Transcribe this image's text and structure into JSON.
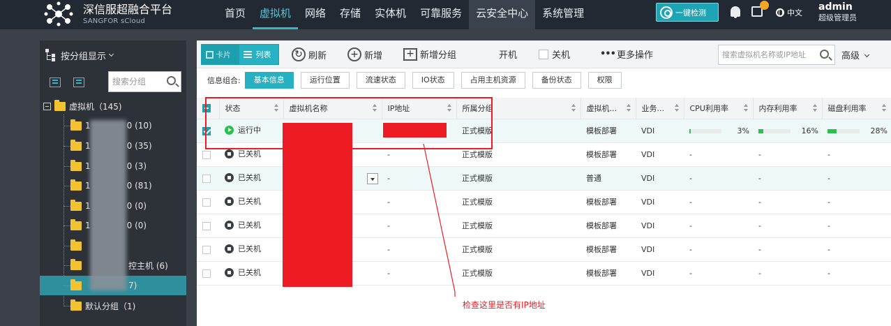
{
  "brand": {
    "title": "深信服超融合平台",
    "subtitle": "SANGFOR sCloud"
  },
  "nav": [
    "首页",
    "虚拟机",
    "网络",
    "存储",
    "实体机",
    "可靠服务",
    "云安全中心",
    "系统管理"
  ],
  "onekey_label": "一键检测",
  "lang": "中文",
  "user": {
    "name": "admin",
    "role": "超级管理员"
  },
  "tree": {
    "display_label": "按分组显示",
    "search_placeholder": "搜索分组",
    "root": "虚拟机（145)",
    "nodes": [
      "1",
      "1",
      "1",
      "1",
      "1",
      "1",
      "",
      "",
      "",
      "默认分组（1)"
    ],
    "suffixes": [
      "0 (10)",
      "0 (35)",
      "0 (3)",
      "0 (81)",
      "0 (0)",
      "0 (0)",
      "",
      "控主机 (6)",
      "7)",
      ""
    ]
  },
  "toolbar": {
    "card": "卡片",
    "list": "列表",
    "refresh": "刷新",
    "add": "新增",
    "add_group": "新增分组",
    "power_on": "开机",
    "power_off": "关机",
    "more": "更多操作",
    "search_placeholder": "搜索虚拟机名称或IP地址",
    "advanced": "高级"
  },
  "combo": {
    "label": "信息组合:",
    "tags": [
      "基本信息",
      "运行位置",
      "流速状态",
      "IO状态",
      "占用主机资源",
      "备份状态",
      "权限"
    ]
  },
  "table": {
    "headers": [
      "状态",
      "虚拟机名称",
      "IP地址",
      "所属分组",
      "虚拟机...",
      "业务...",
      "CPU利用率",
      "内存利用率",
      "磁盘利用率"
    ],
    "rows": [
      {
        "status": "运行中",
        "ip": "",
        "group": "正式模版",
        "type": "模板部署",
        "biz": "VDI",
        "cpu": "3%",
        "mem": "16%",
        "disk": "28%"
      },
      {
        "status": "已关机",
        "ip": "-",
        "group": "正式模版",
        "type": "模板部署",
        "biz": "VDI",
        "cpu": "-",
        "mem": "-",
        "disk": "-"
      },
      {
        "status": "已关机",
        "ip": "-",
        "group": "正式模版",
        "type": "普通",
        "biz": "VDI",
        "cpu": "-",
        "mem": "-",
        "disk": "-"
      },
      {
        "status": "已关机",
        "ip": "-",
        "group": "正式模版",
        "type": "模板部署",
        "biz": "VDI",
        "cpu": "-",
        "mem": "-",
        "disk": "-"
      },
      {
        "status": "已关机",
        "ip": "-",
        "group": "正式模版",
        "type": "模板部署",
        "biz": "VDI",
        "cpu": "-",
        "mem": "-",
        "disk": "-"
      },
      {
        "status": "已关机",
        "ip": "-",
        "group": "正式模版",
        "type": "模板部署",
        "biz": "VDI",
        "cpu": "-",
        "mem": "-",
        "disk": "-"
      },
      {
        "status": "已关机",
        "ip": "-",
        "group": "正式模版",
        "type": "模板部署",
        "biz": "VDI",
        "cpu": "-",
        "mem": "-",
        "disk": "-"
      }
    ],
    "usage": {
      "cpu": 0.03,
      "mem": 0.16,
      "disk": 0.28
    }
  },
  "annotation": "检查这里是否有IP地址",
  "colors": {
    "accent": "#1d9fae",
    "topbar": "#222932",
    "running": "#2bbf4d",
    "annotation": "#ed1c24"
  }
}
